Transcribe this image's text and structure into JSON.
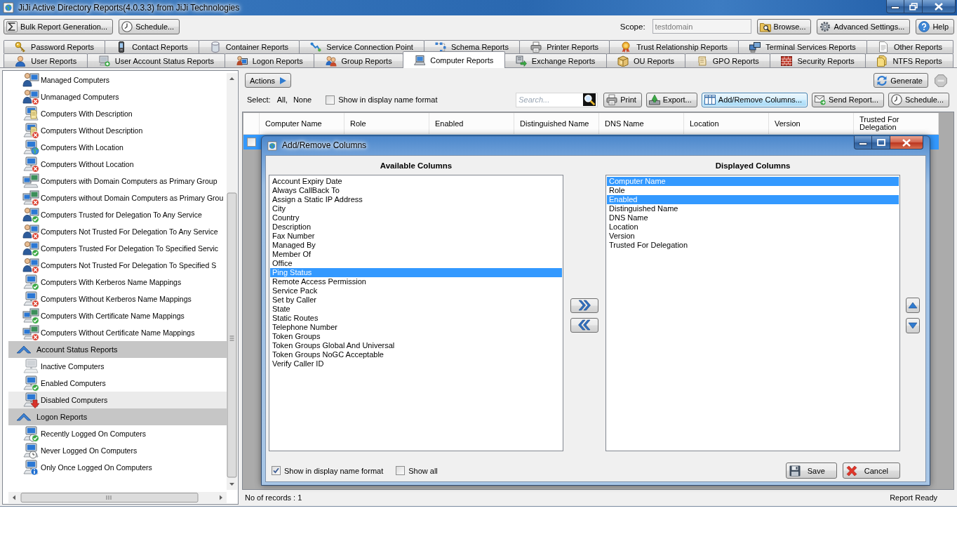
{
  "window": {
    "title": "JiJi Active Directory Reports(4.0.3.3) from JiJi Technologies"
  },
  "toolbar": {
    "left_buttons": [
      {
        "label": "Bulk Report Generation..."
      },
      {
        "label": "Schedule..."
      }
    ],
    "scope": {
      "label": "Scope:",
      "value": "testdomain",
      "disabled": true
    },
    "right_buttons": [
      {
        "label": "Browse..."
      },
      {
        "label": "Advanced Settings..."
      },
      {
        "label": "Help"
      }
    ]
  },
  "tab_rows": [
    {
      "tabs": [
        {
          "label": "Password Reports",
          "selected": false
        },
        {
          "label": "Contact Reports",
          "selected": false
        },
        {
          "label": "Container Reports",
          "selected": false
        },
        {
          "label": "Service Connection Point",
          "selected": false
        },
        {
          "label": "Schema Reports",
          "selected": false
        },
        {
          "label": "Printer Reports",
          "selected": false
        },
        {
          "label": "Trust Relationship Reports",
          "selected": false
        },
        {
          "label": "Terminal Services Reports",
          "selected": false
        },
        {
          "label": "Other Reports",
          "selected": false
        }
      ]
    },
    {
      "tabs": [
        {
          "label": "User Reports",
          "selected": false
        },
        {
          "label": "User Account Status Reports",
          "selected": false
        },
        {
          "label": "Logon Reports",
          "selected": false
        },
        {
          "label": "Group Reports",
          "selected": false
        },
        {
          "label": "Computer Reports",
          "selected": true
        },
        {
          "label": "Exchange Reports",
          "selected": false
        },
        {
          "label": "OU Reports",
          "selected": false
        },
        {
          "label": "GPO Reports",
          "selected": false
        },
        {
          "label": "Security Reports",
          "selected": false
        },
        {
          "label": "NTFS Reports",
          "selected": false
        }
      ]
    }
  ],
  "sidebar": {
    "sections": [
      {
        "items": [
          {
            "label": "Managed Computers",
            "selected": false
          },
          {
            "label": "Unmanaged Computers",
            "selected": false
          },
          {
            "label": "Computers With Description",
            "selected": false
          },
          {
            "label": "Computers Without Description",
            "selected": false
          },
          {
            "label": "Computers With Location",
            "selected": false
          },
          {
            "label": "Computers Without Location",
            "selected": false
          },
          {
            "label": "Computers with Domain Computers as Primary Group",
            "selected": false
          },
          {
            "label": "Computers without Domain Computers as Primary Grou",
            "selected": false
          },
          {
            "label": "Computers Trusted for Delegation To Any Service",
            "selected": false
          },
          {
            "label": "Computers Not Trusted For Delegation To Any Service",
            "selected": false
          },
          {
            "label": "Computers Trusted For Delegation To Specified Servic",
            "selected": false
          },
          {
            "label": "Computers Not Trusted For Delegation To Specified S",
            "selected": false
          },
          {
            "label": "Computers With Kerberos Name Mappings",
            "selected": false
          },
          {
            "label": "Computers Without Kerberos Name Mappings",
            "selected": false
          },
          {
            "label": "Computers With Certificate Name Mappings",
            "selected": false
          },
          {
            "label": "Computers Without Certificate Name Mappings",
            "selected": false
          }
        ]
      },
      {
        "title": "Account Status Reports",
        "expanded": true,
        "items": [
          {
            "label": "Inactive Computers",
            "selected": false
          },
          {
            "label": "Enabled Computers",
            "selected": false
          },
          {
            "label": "Disabled Computers",
            "selected": true
          }
        ]
      },
      {
        "title": "Logon Reports",
        "expanded": true,
        "items": [
          {
            "label": "Recently Logged On Computers",
            "selected": false
          },
          {
            "label": "Never Logged On Computers",
            "selected": false
          },
          {
            "label": "Only Once Logged On Computers",
            "selected": false
          }
        ]
      }
    ]
  },
  "report": {
    "actions_button": "Actions",
    "generate_button": "Generate",
    "stop_button": {
      "disabled": true
    },
    "select": {
      "label": "Select:",
      "links": [
        "All,",
        "None"
      ]
    },
    "display_name_option": {
      "label": "Show in display name format",
      "checked": false
    },
    "search": {
      "placeholder": "Search..."
    },
    "buttons": [
      {
        "label": "Print",
        "focused": false
      },
      {
        "label": "Export...",
        "focused": false
      },
      {
        "label": "Add/Remove Columns...",
        "focused": true
      },
      {
        "label": "Send Report...",
        "focused": false
      },
      {
        "label": "Schedule...",
        "focused": false
      }
    ],
    "grid": {
      "columns": [
        "Computer Name",
        "Role",
        "Enabled",
        "Distinguished Name",
        "DNS Name",
        "Location",
        "Version",
        "Trusted For Delegation"
      ],
      "rows": [
        {
          "selected": true,
          "checked": false
        }
      ]
    },
    "status": {
      "records": "No of records : 1",
      "state": "Report Ready"
    }
  },
  "dialog": {
    "title": "Add/Remove Columns",
    "available": {
      "heading": "Available Columns",
      "items": [
        {
          "label": "Account Expiry Date",
          "selected": false
        },
        {
          "label": "Always CallBack To",
          "selected": false
        },
        {
          "label": "Assign a Static IP Address",
          "selected": false
        },
        {
          "label": "City",
          "selected": false
        },
        {
          "label": "Country",
          "selected": false
        },
        {
          "label": "Description",
          "selected": false
        },
        {
          "label": "Fax Number",
          "selected": false
        },
        {
          "label": "Managed By",
          "selected": false
        },
        {
          "label": "Member Of",
          "selected": false
        },
        {
          "label": "Office",
          "selected": false
        },
        {
          "label": "Ping Status",
          "selected": true
        },
        {
          "label": "Remote Access Permission",
          "selected": false
        },
        {
          "label": "Service Pack",
          "selected": false
        },
        {
          "label": "Set by Caller",
          "selected": false
        },
        {
          "label": "State",
          "selected": false
        },
        {
          "label": "Static Routes",
          "selected": false
        },
        {
          "label": "Telephone Number",
          "selected": false
        },
        {
          "label": "Token Groups",
          "selected": false
        },
        {
          "label": "Token Groups Global And Universal",
          "selected": false
        },
        {
          "label": "Token Groups NoGC Acceptable",
          "selected": false
        },
        {
          "label": "Verify Caller ID",
          "selected": false
        }
      ]
    },
    "displayed": {
      "heading": "Displayed Columns",
      "items": [
        {
          "label": "Computer Name",
          "selected": true
        },
        {
          "label": "Role",
          "selected": false
        },
        {
          "label": "Enabled",
          "selected": true
        },
        {
          "label": "Distinguished Name",
          "selected": false
        },
        {
          "label": "DNS Name",
          "selected": false
        },
        {
          "label": "Location",
          "selected": false
        },
        {
          "label": "Version",
          "selected": false
        },
        {
          "label": "Trusted For Delegation",
          "selected": false
        }
      ]
    },
    "display_name_option": {
      "label": "Show in display name format",
      "checked": true
    },
    "show_all_option": {
      "label": "Show all",
      "checked": false
    },
    "buttons": [
      {
        "label": "Save"
      },
      {
        "label": "Cancel"
      }
    ]
  }
}
